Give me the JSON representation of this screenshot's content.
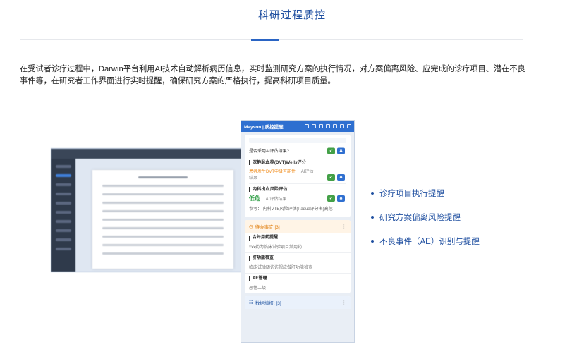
{
  "page": {
    "title": "科研过程质控",
    "intro": "在受试者诊疗过程中，Darwin平台利用AI技术自动解析病历信息，实时监测研究方案的执行情况，对方案偏离风险、应完成的诊疗项目、潜在不良事件等，在研究者工作界面进行实时提醒，确保研究方案的严格执行，提高科研项目质量。"
  },
  "phone": {
    "header": "Mayson | 质控提醒",
    "truncated_hint": "是否采用AI评估结果?",
    "assessments": [
      {
        "name": "深静脉血栓(DVT)Wells评分",
        "result": "患者发生DVT中级可能性",
        "note": "AI评估结果"
      },
      {
        "name": "内科出血风险评估",
        "result": "低危",
        "note": "AI评估结果",
        "ref": "参考：  内科VTE风险评估(Padua评分表)高危"
      }
    ],
    "todo": {
      "header": "待办事宜 [3]",
      "items": [
        {
          "name": "合并用药提醒",
          "sub": "xxx药为临床试验项目禁用药"
        },
        {
          "name": "肝功能检查",
          "sub": "临床试验随访访视应做肝功能检查"
        },
        {
          "name": "AE管理",
          "sub": "恶性二级"
        }
      ]
    },
    "data_fill": {
      "header": "数据填报: [3]"
    }
  },
  "bullets": [
    "诊疗项目执行提醒",
    "研究方案偏离风险提醒",
    "不良事件（AE）识别与提醒"
  ]
}
